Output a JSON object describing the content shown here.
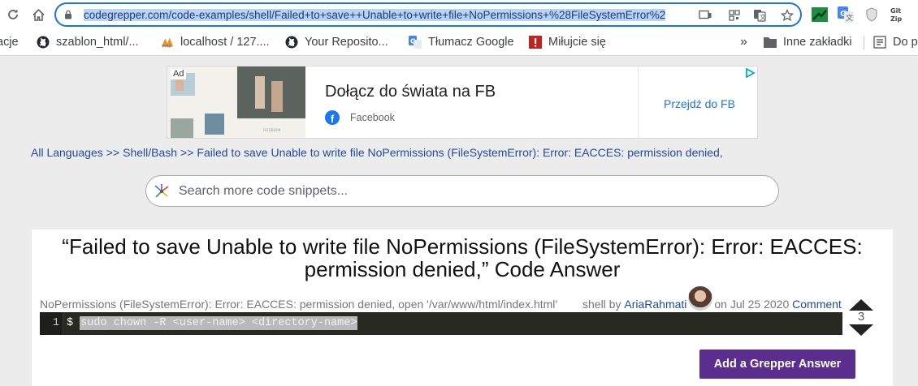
{
  "browser": {
    "url": "codegrepper.com/code-examples/shell/Failed+to+save++Unable+to+write+file+NoPermissions+%28FileSystemError%2",
    "bookmarks": [
      {
        "label": "acje",
        "icon": "none"
      },
      {
        "label": "szablon_html/...",
        "icon": "github-icon"
      },
      {
        "label": "localhost / 127....",
        "icon": "phpmyadmin-icon"
      },
      {
        "label": "Your Reposito...",
        "icon": "github-icon"
      },
      {
        "label": "Tłumacz Google",
        "icon": "google-translate-icon"
      },
      {
        "label": "Miłujcie się",
        "icon": "exclamation-icon"
      }
    ],
    "overflow": "»",
    "other_bookmarks": "Inne zakładki",
    "reading_list": "Do p"
  },
  "ad": {
    "badge": "Ad",
    "title": "Dołącz do świata na FB",
    "brand": "Facebook",
    "brand_letter": "f",
    "cta": "Przejdź do FB",
    "image_caption": "FACEBOOK"
  },
  "breadcrumb": {
    "items": [
      "All Languages",
      "Shell/Bash",
      "Failed to save Unable to write file NoPermissions (FileSystemError): Error: EACCES: permission denied,"
    ],
    "separator": ">>"
  },
  "search": {
    "placeholder": "Search more code snippets..."
  },
  "answer": {
    "title": "“Failed to save Unable to write file NoPermissions (FileSystemError): Error: EACCES: permission denied,” Code Answer",
    "source": "NoPermissions (FileSystemError): Error: EACCES: permission denied, open '/var/www/html/index.html'",
    "lang_by": "shell by",
    "author": "AriaRahmati",
    "date": "on Jul 25 2020",
    "comment": "Comment",
    "line_no": "1",
    "prompt": "$ ",
    "code": "sudo chown -R <user-name> <directory-name>",
    "votes": "3"
  },
  "add_button": "Add a Grepper Answer",
  "colors": {
    "accent": "#5b2d8e",
    "link": "#1f4aa0",
    "url_focus": "#1a73e8"
  }
}
